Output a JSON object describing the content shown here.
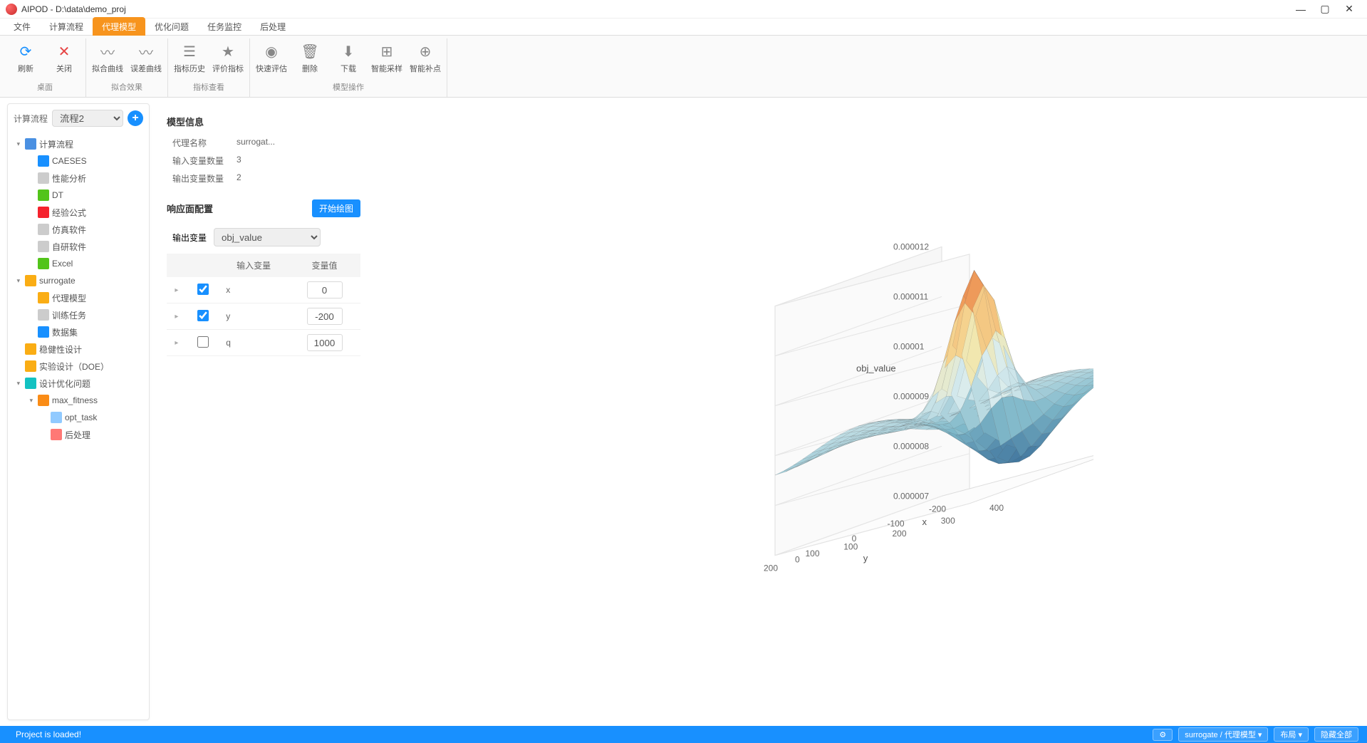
{
  "window": {
    "title": "AIPOD - D:\\data\\demo_proj",
    "minimize": "—",
    "maximize": "▢",
    "close": "✕"
  },
  "menu_tabs": [
    "文件",
    "计算流程",
    "代理模型",
    "优化问题",
    "任务监控",
    "后处理"
  ],
  "menu_active_index": 2,
  "ribbon": {
    "groups": [
      {
        "label": "桌面",
        "buttons": [
          {
            "id": "refresh",
            "label": "刷新",
            "color": "#1890ff",
            "glyph": "⟳"
          },
          {
            "id": "close",
            "label": "关闭",
            "color": "#e64545",
            "glyph": "✕"
          }
        ]
      },
      {
        "label": "拟合效果",
        "buttons": [
          {
            "id": "fit-curve",
            "label": "拟合曲线",
            "color": "#888",
            "glyph": "〰"
          },
          {
            "id": "err-curve",
            "label": "误差曲线",
            "color": "#888",
            "glyph": "〰"
          }
        ]
      },
      {
        "label": "指标查看",
        "buttons": [
          {
            "id": "metric-hist",
            "label": "指标历史",
            "color": "#888",
            "glyph": "☰"
          },
          {
            "id": "eval-metric",
            "label": "评价指标",
            "color": "#888",
            "glyph": "★"
          }
        ]
      },
      {
        "label": "模型操作",
        "buttons": [
          {
            "id": "fast-eval",
            "label": "快速评估",
            "color": "#888",
            "glyph": "◉"
          },
          {
            "id": "delete",
            "label": "删除",
            "color": "#888",
            "glyph": "🗑"
          },
          {
            "id": "download",
            "label": "下载",
            "color": "#888",
            "glyph": "⬇"
          },
          {
            "id": "smart-sample",
            "label": "智能采样",
            "color": "#888",
            "glyph": "⊞"
          },
          {
            "id": "smart-fill",
            "label": "智能补点",
            "color": "#888",
            "glyph": "⊕"
          }
        ]
      }
    ]
  },
  "sidebar": {
    "label": "计算流程",
    "selected_flow": "流程2",
    "tree": [
      {
        "d": 0,
        "caret": true,
        "icon": "#4a90e2",
        "label": "计算流程"
      },
      {
        "d": 1,
        "caret": false,
        "icon": "#1890ff",
        "label": "CAESES"
      },
      {
        "d": 1,
        "caret": false,
        "icon": "#ccc",
        "label": "性能分析"
      },
      {
        "d": 1,
        "caret": false,
        "icon": "#52c41a",
        "label": "DT"
      },
      {
        "d": 1,
        "caret": false,
        "icon": "#f5222d",
        "label": "经验公式"
      },
      {
        "d": 1,
        "caret": false,
        "icon": "#ccc",
        "label": "仿真软件"
      },
      {
        "d": 1,
        "caret": false,
        "icon": "#ccc",
        "label": "自研软件"
      },
      {
        "d": 1,
        "caret": false,
        "icon": "#52c41a",
        "label": "Excel"
      },
      {
        "d": 0,
        "caret": true,
        "icon": "#faad14",
        "label": "surrogate"
      },
      {
        "d": 1,
        "caret": false,
        "icon": "#faad14",
        "label": "代理模型"
      },
      {
        "d": 1,
        "caret": false,
        "icon": "#ccc",
        "label": "训练任务"
      },
      {
        "d": 1,
        "caret": false,
        "icon": "#1890ff",
        "label": "数据集"
      },
      {
        "d": 0,
        "caret": false,
        "icon": "#faad14",
        "label": "稳健性设计"
      },
      {
        "d": 0,
        "caret": false,
        "icon": "#faad14",
        "label": "实验设计（DOE）"
      },
      {
        "d": 0,
        "caret": true,
        "icon": "#13c2c2",
        "label": "设计优化问题"
      },
      {
        "d": 1,
        "caret": true,
        "icon": "#fa8c16",
        "label": "max_fitness"
      },
      {
        "d": 2,
        "caret": false,
        "icon": "#91caff",
        "label": "opt_task"
      },
      {
        "d": 2,
        "caret": false,
        "icon": "#ff7875",
        "label": "后处理"
      }
    ]
  },
  "model_info": {
    "heading": "模型信息",
    "rows": [
      {
        "k": "代理名称",
        "v": "surrogat..."
      },
      {
        "k": "输入变量数量",
        "v": "3"
      },
      {
        "k": "输出变量数量",
        "v": "2"
      }
    ]
  },
  "response_surface": {
    "heading": "响应面配置",
    "plot_button": "开始绘图",
    "output_label": "输出变量",
    "output_selected": "obj_value",
    "columns": [
      "",
      "",
      "输入变量",
      "变量值"
    ],
    "rows": [
      {
        "checked": true,
        "name": "x",
        "value": "0"
      },
      {
        "checked": true,
        "name": "y",
        "value": "-200"
      },
      {
        "checked": false,
        "name": "q",
        "value": "1000"
      }
    ]
  },
  "chart_data": {
    "type": "surface3d",
    "zlabel": "obj_value",
    "xlabel": "x",
    "ylabel": "y",
    "x_ticks": [
      0,
      100,
      200,
      300,
      400
    ],
    "y_ticks": [
      -200,
      -100,
      0,
      100,
      200
    ],
    "z_ticks": [
      7e-06,
      8e-06,
      9e-06,
      1e-05,
      1.1e-05,
      1.2e-05
    ],
    "z_tick_labels": [
      "0.000007",
      "0.000008",
      "0.000009",
      "0.00001",
      "0.000011",
      "0.000012"
    ],
    "x_range": [
      0,
      400
    ],
    "y_range": [
      -200,
      200
    ],
    "z_range": [
      7e-06,
      1.2e-05
    ],
    "peak_approx": {
      "x": 200,
      "y": -50,
      "z": 1.2e-05
    },
    "description": "Response surface with a sharp central peak near (x≈200,y≈-50) reaching ~1.2e-5, dipping toward ~7e-6 at negative y, shallow saddle/ridge around z≈9e-6 elsewhere."
  },
  "status": {
    "message": "Project is loaded!",
    "gear": "⚙",
    "model_select": "surrogate / 代理模型 ▾",
    "layout": "布局 ▾",
    "hide_all": "隐藏全部"
  }
}
